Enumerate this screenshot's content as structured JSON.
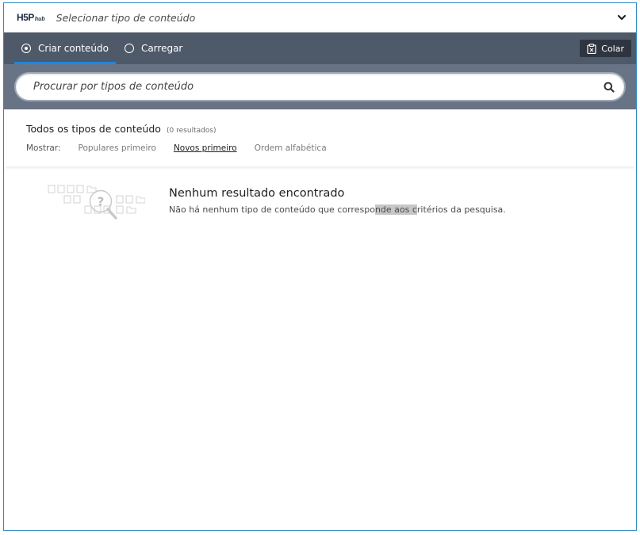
{
  "header": {
    "logo_main": "H5P",
    "logo_sub": "hub",
    "title": "Selecionar tipo de conteúdo",
    "toggle_icon": "chevron-down-icon"
  },
  "tabs": [
    {
      "label": "Criar conteúdo",
      "active": true
    },
    {
      "label": "Carregar",
      "active": false
    }
  ],
  "paste_button": {
    "label": "Colar",
    "icon": "clipboard-icon"
  },
  "search": {
    "placeholder": "Procurar por tipos de conteúdo",
    "value": "",
    "icon": "search-icon"
  },
  "results": {
    "title": "Todos os tipos de conteúdo",
    "count": "(0 resultados)",
    "show_label": "Mostrar:",
    "sort_options": [
      {
        "label": "Populares primeiro",
        "active": false
      },
      {
        "label": "Novos primeiro",
        "active": true
      },
      {
        "label": "Ordem alfabética",
        "active": false
      }
    ]
  },
  "empty_state": {
    "title": "Nenhum resultado encontrado",
    "desc_before": "Não há nenhum tipo de conteúdo que correspo",
    "desc_highlight": "nde aos c",
    "desc_after": "ritérios da pesquisa.",
    "icon": "no-results-illustration"
  },
  "colors": {
    "tab_bar": "#4e5a6a",
    "search_area": "#687485",
    "active_tab_underline": "#1e88e5",
    "frame_border": "#2f89c4"
  }
}
